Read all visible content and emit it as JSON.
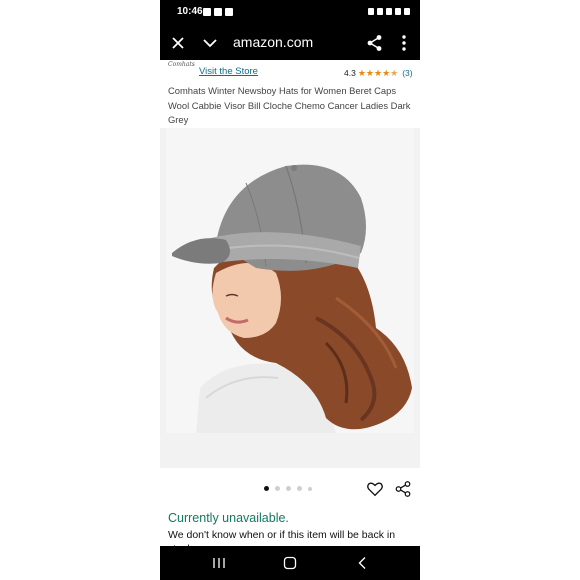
{
  "status_bar": {
    "time": "10:46",
    "icons": [
      "gallery-icon",
      "image-icon",
      "app-icon"
    ],
    "right_icons": [
      "alarm-icon",
      "mute-icon",
      "wifi-icon",
      "signal-icon",
      "battery-icon"
    ]
  },
  "browser": {
    "url": "amazon.com",
    "buttons": [
      "close-icon",
      "chevron-down-icon",
      "share-icon",
      "more-vert-icon"
    ]
  },
  "product": {
    "brand_logo": "Comhats",
    "store_link": "Visit the Store",
    "rating": "4.3",
    "rating_stars": 4.3,
    "review_count": "(3)",
    "title": "Comhats Winter Newsboy Hats for Women Beret Caps Wool Cabbie Visor Bill Cloche Chemo Cancer Ladies Dark Grey",
    "image_description_icon": "product-photo",
    "image_dots": {
      "count": 5,
      "active_index": 0
    },
    "availability": "Currently unavailable.",
    "stock_note": "We don't know when or if this item will be back in stock."
  },
  "colors": {
    "availability": "#127a5f",
    "link": "#0f6c8a",
    "star": "#e8890f",
    "chrome": "#000000"
  },
  "nav_bar": {
    "buttons": [
      "recent-apps-icon",
      "home-icon",
      "back-icon"
    ]
  }
}
